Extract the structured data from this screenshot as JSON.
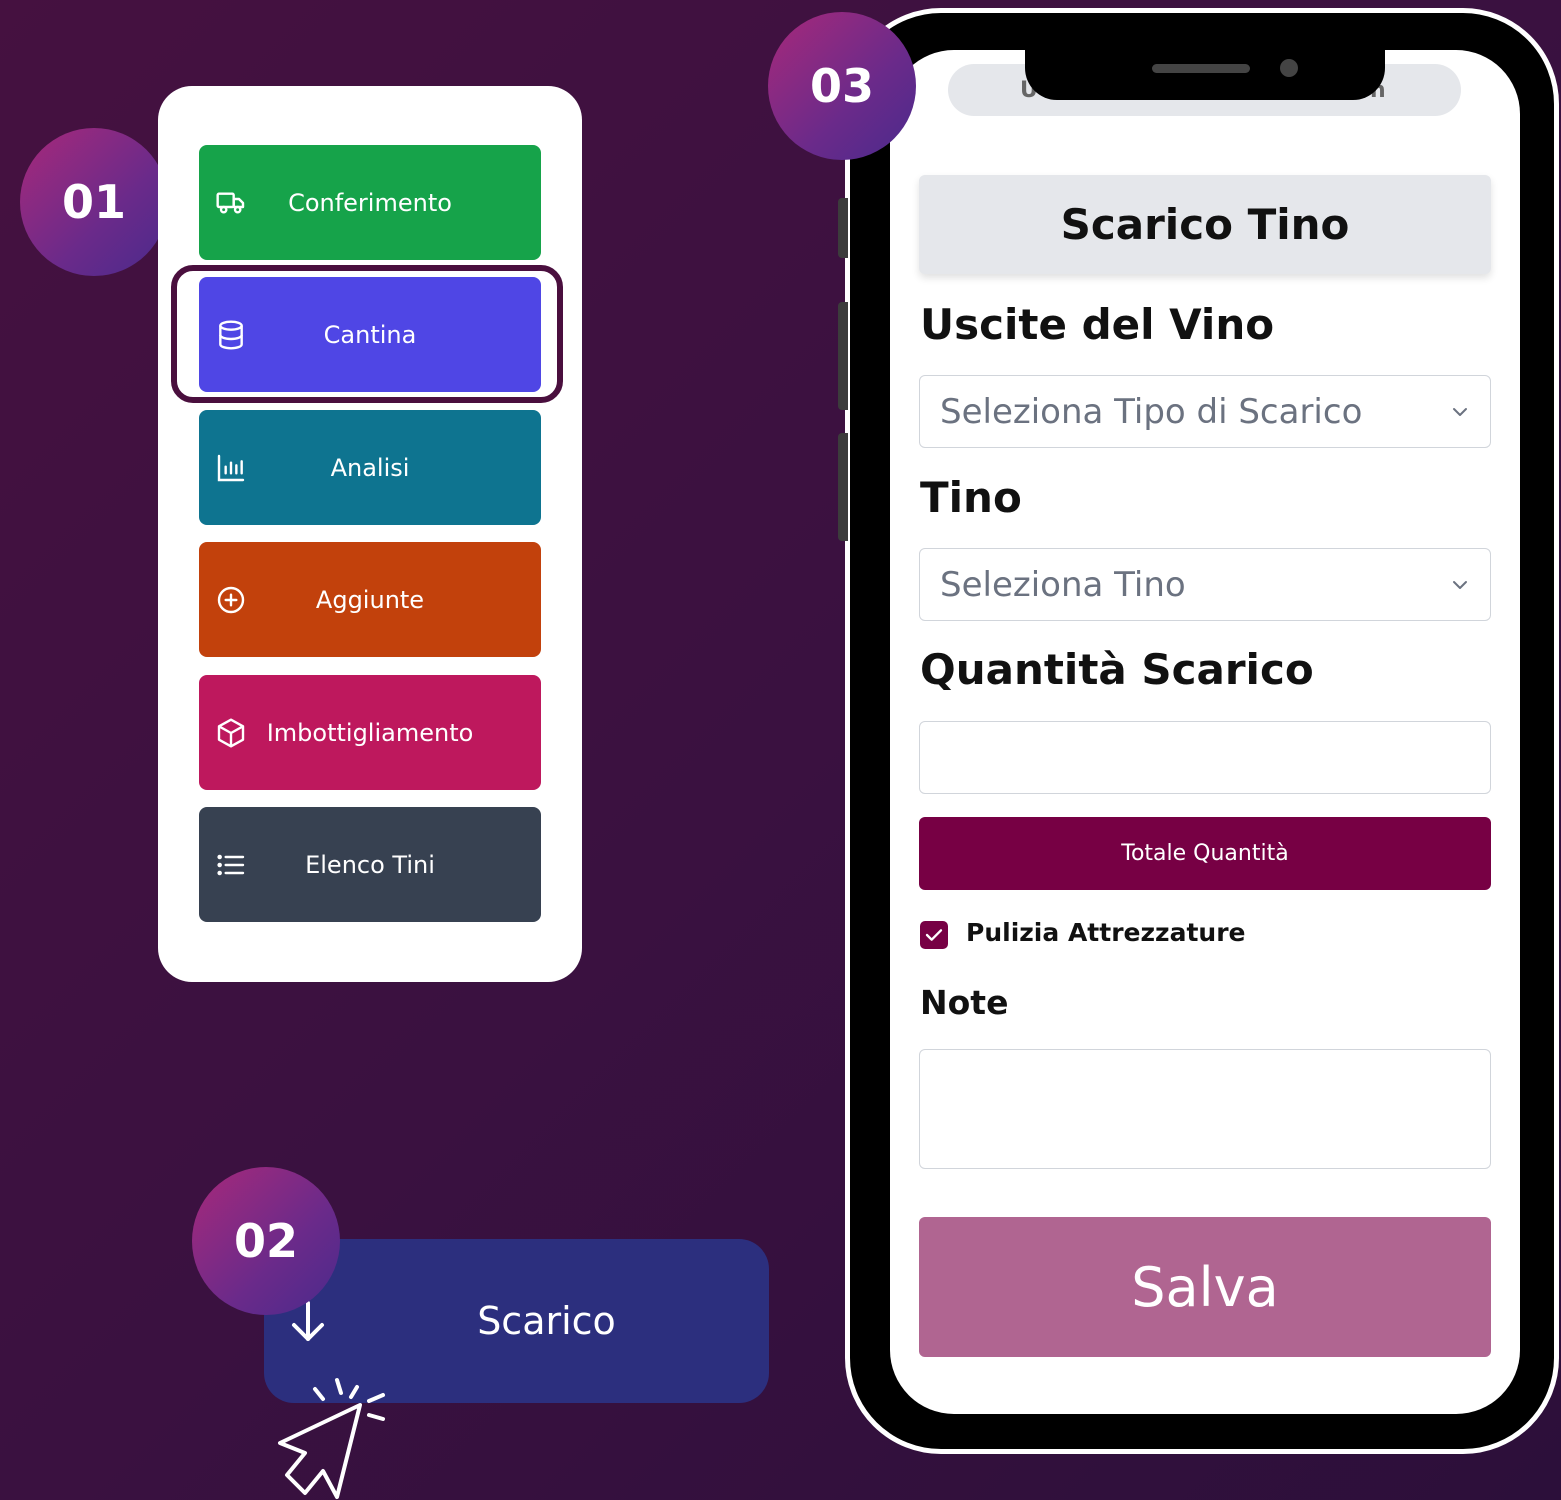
{
  "badges": {
    "b1": "01",
    "b2": "02",
    "b3": "03"
  },
  "menu": {
    "items": [
      {
        "label": "Conferimento",
        "icon": "truck-icon",
        "color": "#16a34a"
      },
      {
        "label": "Cantina",
        "icon": "database-icon",
        "color": "#4f46e5"
      },
      {
        "label": "Analisi",
        "icon": "bar-chart-icon",
        "color": "#0e7490"
      },
      {
        "label": "Aggiunte",
        "icon": "plus-circle-icon",
        "color": "#c2410c"
      },
      {
        "label": "Imbottigliamento",
        "icon": "box-icon",
        "color": "#be185d"
      },
      {
        "label": "Elenco Tini",
        "icon": "list-icon",
        "color": "#374151"
      }
    ]
  },
  "scarico": {
    "label": "Scarico",
    "icon": "arrow-down-icon"
  },
  "phone": {
    "top_pill_left": "U",
    "top_pill_right": "n",
    "title": "Scarico Tino",
    "section_uscite": "Uscite del Vino",
    "select_tipo_placeholder": "Seleziona Tipo di Scarico",
    "section_tino": "Tino",
    "select_tino_placeholder": "Seleziona Tino",
    "section_quantita": "Quantità Scarico",
    "totale_button": "Totale Quantità",
    "checkbox_label": "Pulizia Attrezzature",
    "checkbox_checked": true,
    "note_label": "Note",
    "save_button": "Salva"
  },
  "colors": {
    "accent": "#770044",
    "save": "#b06591",
    "scarico_bg": "#2c2f7e"
  }
}
